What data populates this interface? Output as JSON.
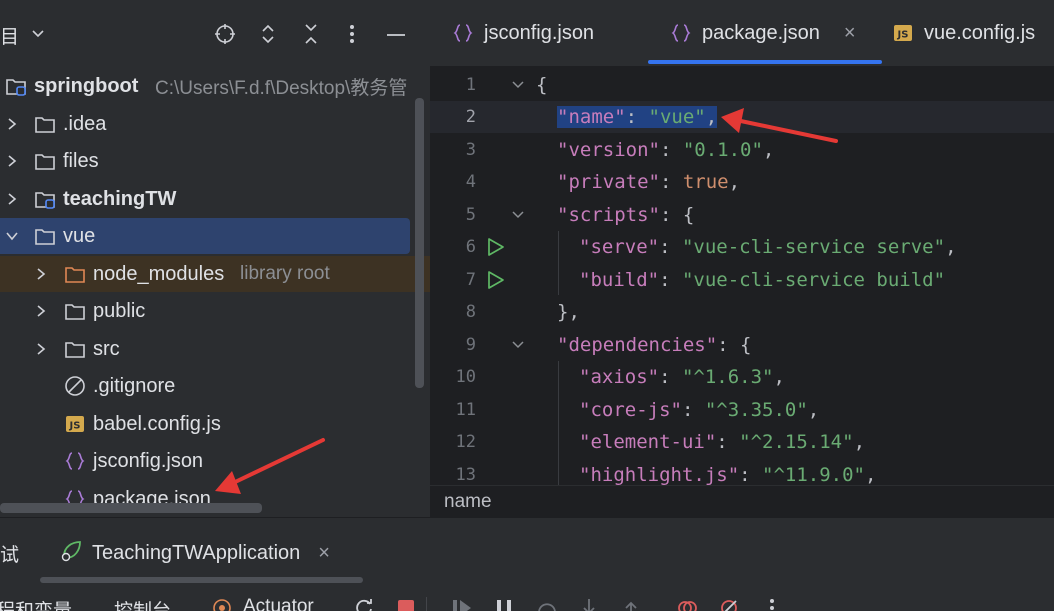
{
  "project_panel": {
    "title": "目",
    "tree": [
      {
        "label": "springboot",
        "path": "C:\\Users\\F.d.f\\Desktop\\教务管",
        "bold": true
      },
      {
        "label": ".idea"
      },
      {
        "label": "files"
      },
      {
        "label": "teachingTW",
        "bold": true
      },
      {
        "label": "vue"
      },
      {
        "label": "node_modules",
        "extra": "library root"
      },
      {
        "label": "public"
      },
      {
        "label": "src"
      },
      {
        "label": ".gitignore"
      },
      {
        "label": "babel.config.js",
        "badge": "JS"
      },
      {
        "label": "jsconfig.json",
        "badge": "{}"
      },
      {
        "label": "package.json",
        "badge": "{}"
      }
    ]
  },
  "editor": {
    "tabs": [
      {
        "label": "jsconfig.json",
        "icon": "{}"
      },
      {
        "label": "package.json",
        "icon": "{}",
        "close": "×"
      },
      {
        "label": "vue.config.js",
        "icon": "JS"
      }
    ],
    "line_numbers": [
      "1",
      "2",
      "3",
      "4",
      "5",
      "6",
      "7",
      "8",
      "9",
      "10",
      "11",
      "12",
      "13"
    ],
    "code": {
      "l1": "{",
      "l2_key": "\"name\"",
      "l2_colon": ": ",
      "l2_val": "\"vue\"",
      "l2_end": ",",
      "l3_key": "\"version\"",
      "l3_colon": ": ",
      "l3_val": "\"0.1.0\"",
      "l3_end": ",",
      "l4_key": "\"private\"",
      "l4_colon": ": ",
      "l4_val": "true",
      "l4_end": ",",
      "l5_key": "\"scripts\"",
      "l5_rest": ": {",
      "l6_key": "\"serve\"",
      "l6_colon": ": ",
      "l6_val": "\"vue-cli-service serve\"",
      "l6_end": ",",
      "l7_key": "\"build\"",
      "l7_colon": ": ",
      "l7_val": "\"vue-cli-service build\"",
      "l8": "},",
      "l9_key": "\"dependencies\"",
      "l9_rest": ": {",
      "l10_key": "\"axios\"",
      "l10_colon": ": ",
      "l10_val": "\"^1.6.3\"",
      "l10_end": ",",
      "l11_key": "\"core-js\"",
      "l11_colon": ": ",
      "l11_val": "\"^3.35.0\"",
      "l11_end": ",",
      "l12_key": "\"element-ui\"",
      "l12_colon": ": ",
      "l12_val": "\"^2.15.14\"",
      "l12_end": ",",
      "l13_key": "\"highlight.js\"",
      "l13_colon": ": ",
      "l13_val": "\"^11.9.0\"",
      "l13_end": ","
    },
    "breadcrumb": "name"
  },
  "run_panel": {
    "title": "试",
    "run_tab": "TeachingTWApplication",
    "close": "×",
    "bottom_tabs": [
      "程和变量",
      "控制台",
      "Actuator"
    ]
  },
  "colors": {
    "accent": "#3574f0",
    "selection": "#2e436e",
    "annotation": "#e53935"
  }
}
